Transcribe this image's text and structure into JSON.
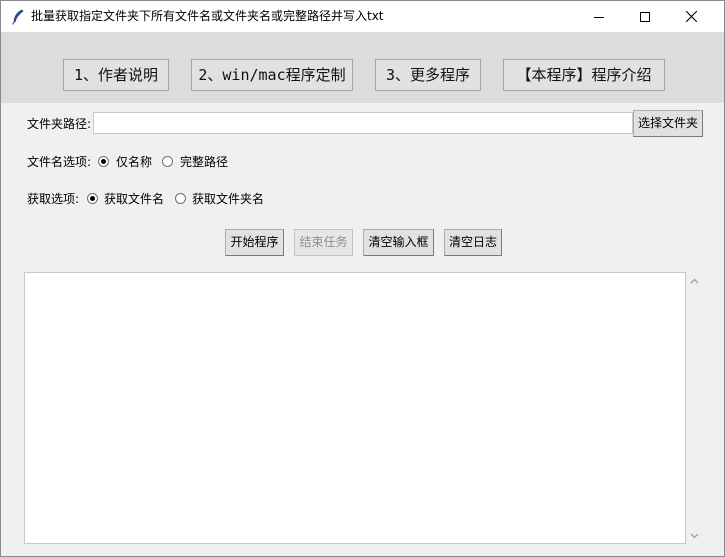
{
  "window": {
    "title": "批量获取指定文件夹下所有文件名或文件夹名或完整路径并写入txt"
  },
  "toolbar": {
    "buttons": [
      "1、作者说明",
      "2、win/mac程序定制",
      "3、更多程序",
      "【本程序】程序介绍"
    ]
  },
  "folder": {
    "label": "文件夹路径:",
    "value": "",
    "select_label": "选择文件夹"
  },
  "name_option": {
    "label": "文件名选项:",
    "options": [
      "仅名称",
      "完整路径"
    ],
    "selected": "仅名称"
  },
  "fetch_option": {
    "label": "获取选项:",
    "options": [
      "获取文件名",
      "获取文件夹名"
    ],
    "selected": "获取文件名"
  },
  "actions": {
    "start": "开始程序",
    "stop": "结束任务",
    "clear_input": "清空输入框",
    "clear_log": "清空日志"
  },
  "log": {
    "content": ""
  }
}
